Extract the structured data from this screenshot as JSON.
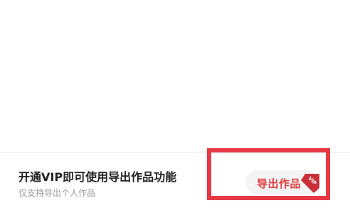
{
  "vip_bar": {
    "title": "开通VIP即可使用导出作品功能",
    "subtitle": "仅支持导出个人作品"
  },
  "export_button": {
    "label": "导出作品",
    "badge_text": "VIP"
  },
  "colors": {
    "accent": "#e23a3a",
    "highlight": "#e63946",
    "badge": "#c9303a"
  },
  "icons": {
    "badge": "vip-badge-icon"
  }
}
